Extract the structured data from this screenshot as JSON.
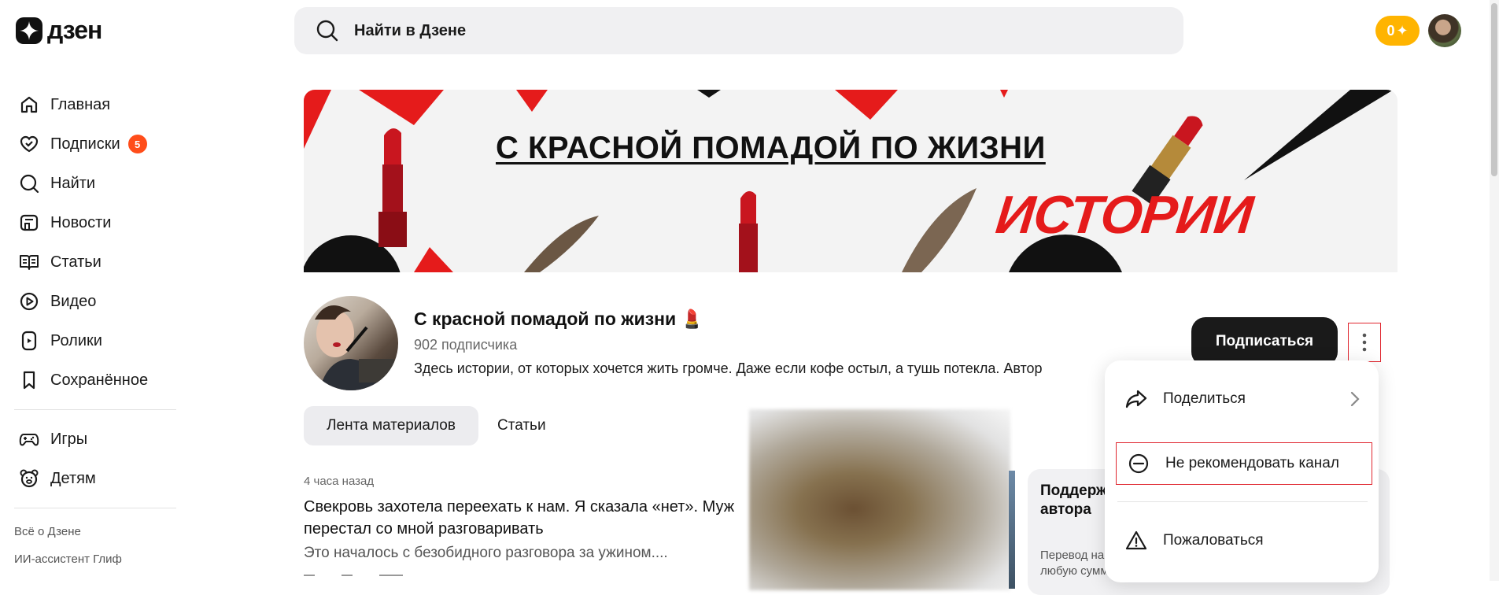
{
  "header": {
    "logo_text": "дзен",
    "search_placeholder": "Найти в Дзене",
    "coins": "0",
    "coins_icon": "sparkle-icon"
  },
  "sidebar": {
    "items": [
      {
        "label": "Главная",
        "icon": "home-icon"
      },
      {
        "label": "Подписки",
        "icon": "subscriptions-icon",
        "badge": "5"
      },
      {
        "label": "Найти",
        "icon": "search-icon"
      },
      {
        "label": "Новости",
        "icon": "news-icon"
      },
      {
        "label": "Статьи",
        "icon": "articles-icon"
      },
      {
        "label": "Видео",
        "icon": "video-icon"
      },
      {
        "label": "Ролики",
        "icon": "shorts-icon"
      },
      {
        "label": "Сохранённое",
        "icon": "bookmark-icon"
      }
    ],
    "extra_items": [
      {
        "label": "Игры",
        "icon": "gamepad-icon"
      },
      {
        "label": "Детям",
        "icon": "bear-icon"
      }
    ],
    "footer_links": [
      "Всё о Дзене",
      "ИИ-ассистент Глиф"
    ]
  },
  "banner": {
    "title": "С КРАСНОЙ ПОМАДОЙ ПО ЖИЗНИ",
    "subtitle": "ИСТОРИИ"
  },
  "channel": {
    "name": "С красной помадой по жизни",
    "name_emoji": "💄",
    "subscribers": "902 подписчика",
    "description": "Здесь истории, от которых хочется жить громче. Даже если кофе остыл, а тушь потекла. Автор",
    "subscribe_label": "Подписаться"
  },
  "tabs": [
    {
      "label": "Лента материалов",
      "active": true
    },
    {
      "label": "Статьи",
      "active": false
    }
  ],
  "feed": {
    "time": "4 часа назад",
    "title": "Свекровь захотела переехать к нам. Я сказала «нет». Муж перестал со мной разговаривать",
    "snippet": "Это началось с безобидного разговора за ужином....",
    "support_title": "Поддержать автора",
    "support_sub": "Перевод на любую сумму"
  },
  "menu": {
    "share_label": "Поделиться",
    "hide_label": "Не рекомендовать канал",
    "report_label": "Пожаловаться"
  },
  "colors": {
    "accent": "#e51b1b",
    "badge": "#ff4d1a",
    "coins": "#ffb400",
    "dark_button": "#1a1a1a"
  }
}
